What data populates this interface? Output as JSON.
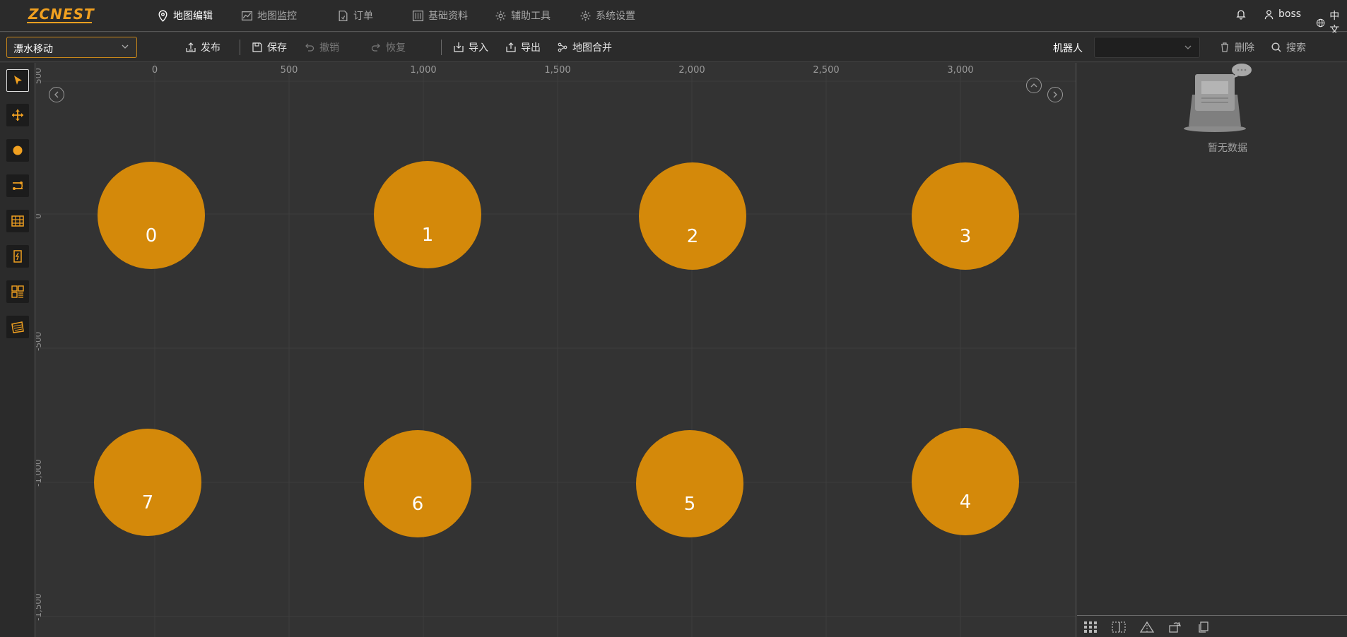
{
  "brand": {
    "logo_text": "ZCNEST",
    "accent": "#f0a020"
  },
  "nav": {
    "items": [
      {
        "label": "地图编辑",
        "icon": "map-pin-icon",
        "active": true
      },
      {
        "label": "地图监控",
        "icon": "line-chart-icon",
        "active": false
      },
      {
        "label": "订单",
        "icon": "document-icon",
        "active": false
      },
      {
        "label": "基础资料",
        "icon": "sliders-icon",
        "active": false
      },
      {
        "label": "辅助工具",
        "icon": "gear-icon",
        "active": false
      },
      {
        "label": "系统设置",
        "icon": "gear-icon",
        "active": false
      }
    ],
    "user": "boss",
    "language": "中文"
  },
  "toolbar": {
    "map_select_value": "漂水移动",
    "publish_label": "发布",
    "save_label": "保存",
    "undo_label": "撤销",
    "redo_label": "恢复",
    "import_label": "导入",
    "export_label": "导出",
    "merge_label": "地图合并",
    "robot_label": "机器人",
    "robot_select_value": "",
    "delete_label": "删除",
    "search_label": "搜索"
  },
  "left_tools": [
    {
      "name": "select-tool",
      "icon": "pointer-arrow-icon",
      "active": true
    },
    {
      "name": "move-tool",
      "icon": "move-arrows-icon",
      "active": false
    },
    {
      "name": "point-tool",
      "icon": "circle-dot-icon",
      "active": false
    },
    {
      "name": "path-tool",
      "icon": "path-connect-icon",
      "active": false
    },
    {
      "name": "shelf-tool",
      "icon": "shelf-grid-icon",
      "active": false
    },
    {
      "name": "charger-tool",
      "icon": "charger-icon",
      "active": false
    },
    {
      "name": "area-tool",
      "icon": "grid-area-icon",
      "active": false
    },
    {
      "name": "region-tool",
      "icon": "hatched-region-icon",
      "active": false
    }
  ],
  "canvas": {
    "x_ticks": [
      "0",
      "500",
      "1,000",
      "1,500",
      "2,000",
      "2,500",
      "3,000"
    ],
    "y_ticks": [
      "500",
      "0",
      "-500",
      "-1,000",
      "-1,500"
    ],
    "nodes": [
      {
        "label": "0"
      },
      {
        "label": "1"
      },
      {
        "label": "2"
      },
      {
        "label": "3"
      },
      {
        "label": "7"
      },
      {
        "label": "6"
      },
      {
        "label": "5"
      },
      {
        "label": "4"
      }
    ],
    "node_color": "#d4890a"
  },
  "right_panel": {
    "empty_text": "暂无数据"
  }
}
